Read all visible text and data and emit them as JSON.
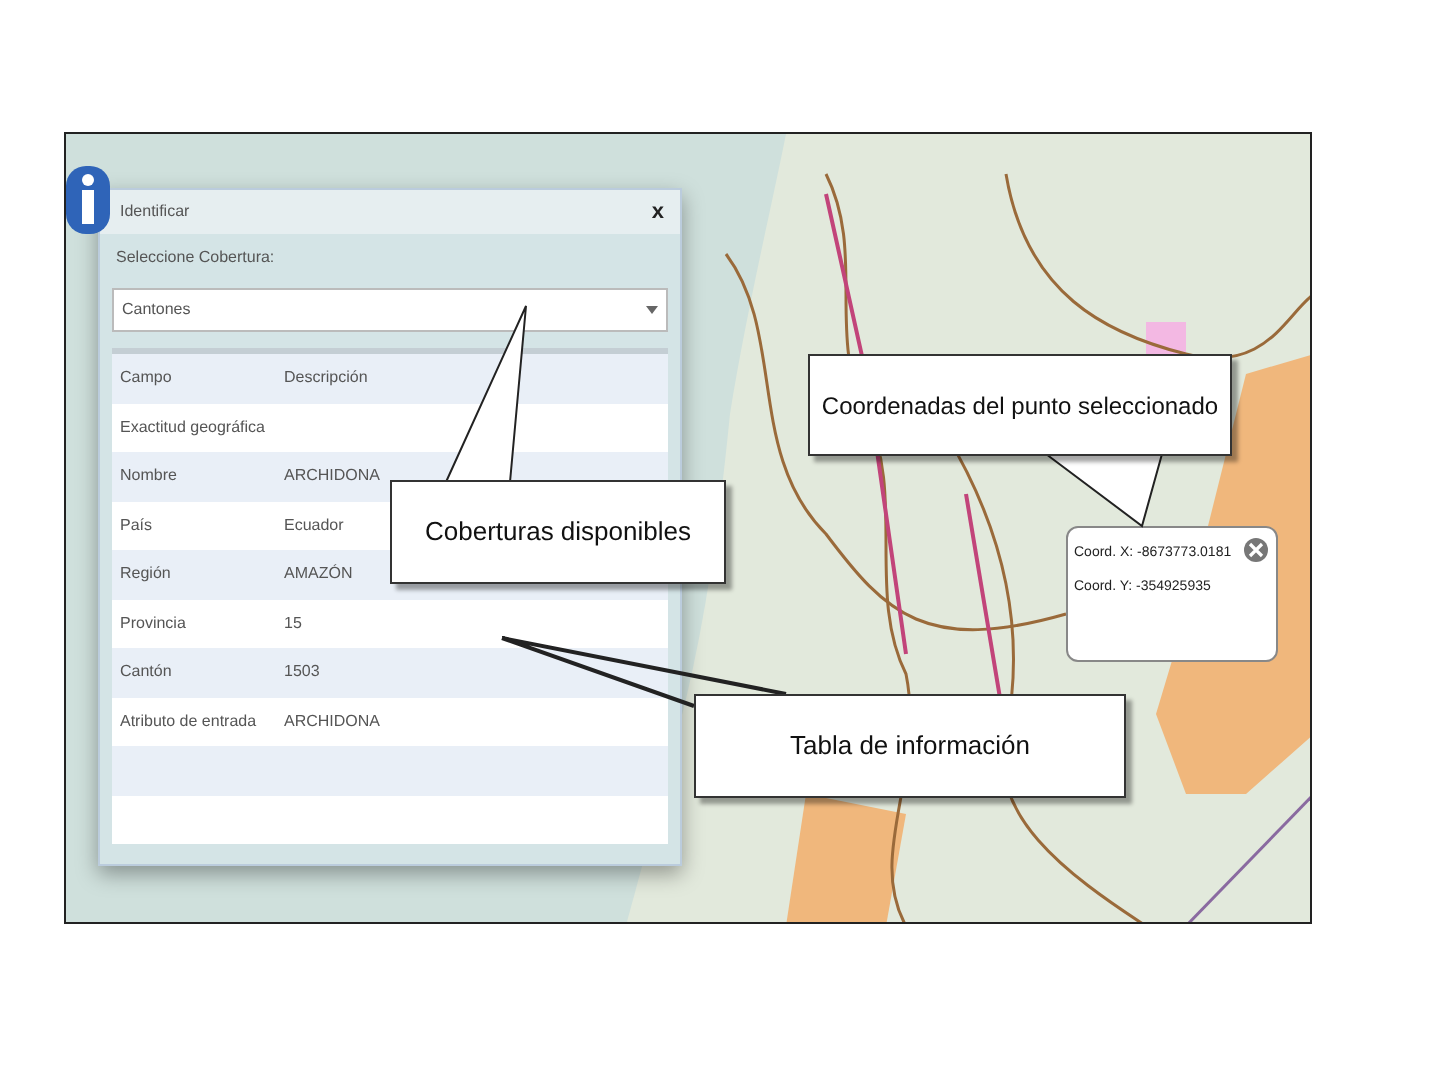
{
  "dialog": {
    "title": "Identificar",
    "close": "x",
    "cover_label": "Seleccione Cobertura:",
    "cover_value": "Cantones",
    "table": {
      "columns": [
        "Campo",
        "Descripción"
      ],
      "rows": [
        [
          "Exactitud geográfica",
          ""
        ],
        [
          "Nombre",
          "ARCHIDONA"
        ],
        [
          "País",
          "Ecuador"
        ],
        [
          "Región",
          "AMAZÓN"
        ],
        [
          "Provincia",
          "15"
        ],
        [
          "Cantón",
          "1503"
        ],
        [
          "Atributo de entrada",
          "ARCHIDONA"
        ],
        [
          "",
          ""
        ],
        [
          "",
          ""
        ]
      ]
    }
  },
  "popup": {
    "lines": [
      "Coord. X: -8673773.0181",
      "Coord. Y: -354925935"
    ]
  },
  "callouts": [
    {
      "text": "Coberturas disponibles"
    },
    {
      "text": "Coordenadas del punto seleccionado"
    },
    {
      "text": "Tabla de información"
    }
  ]
}
